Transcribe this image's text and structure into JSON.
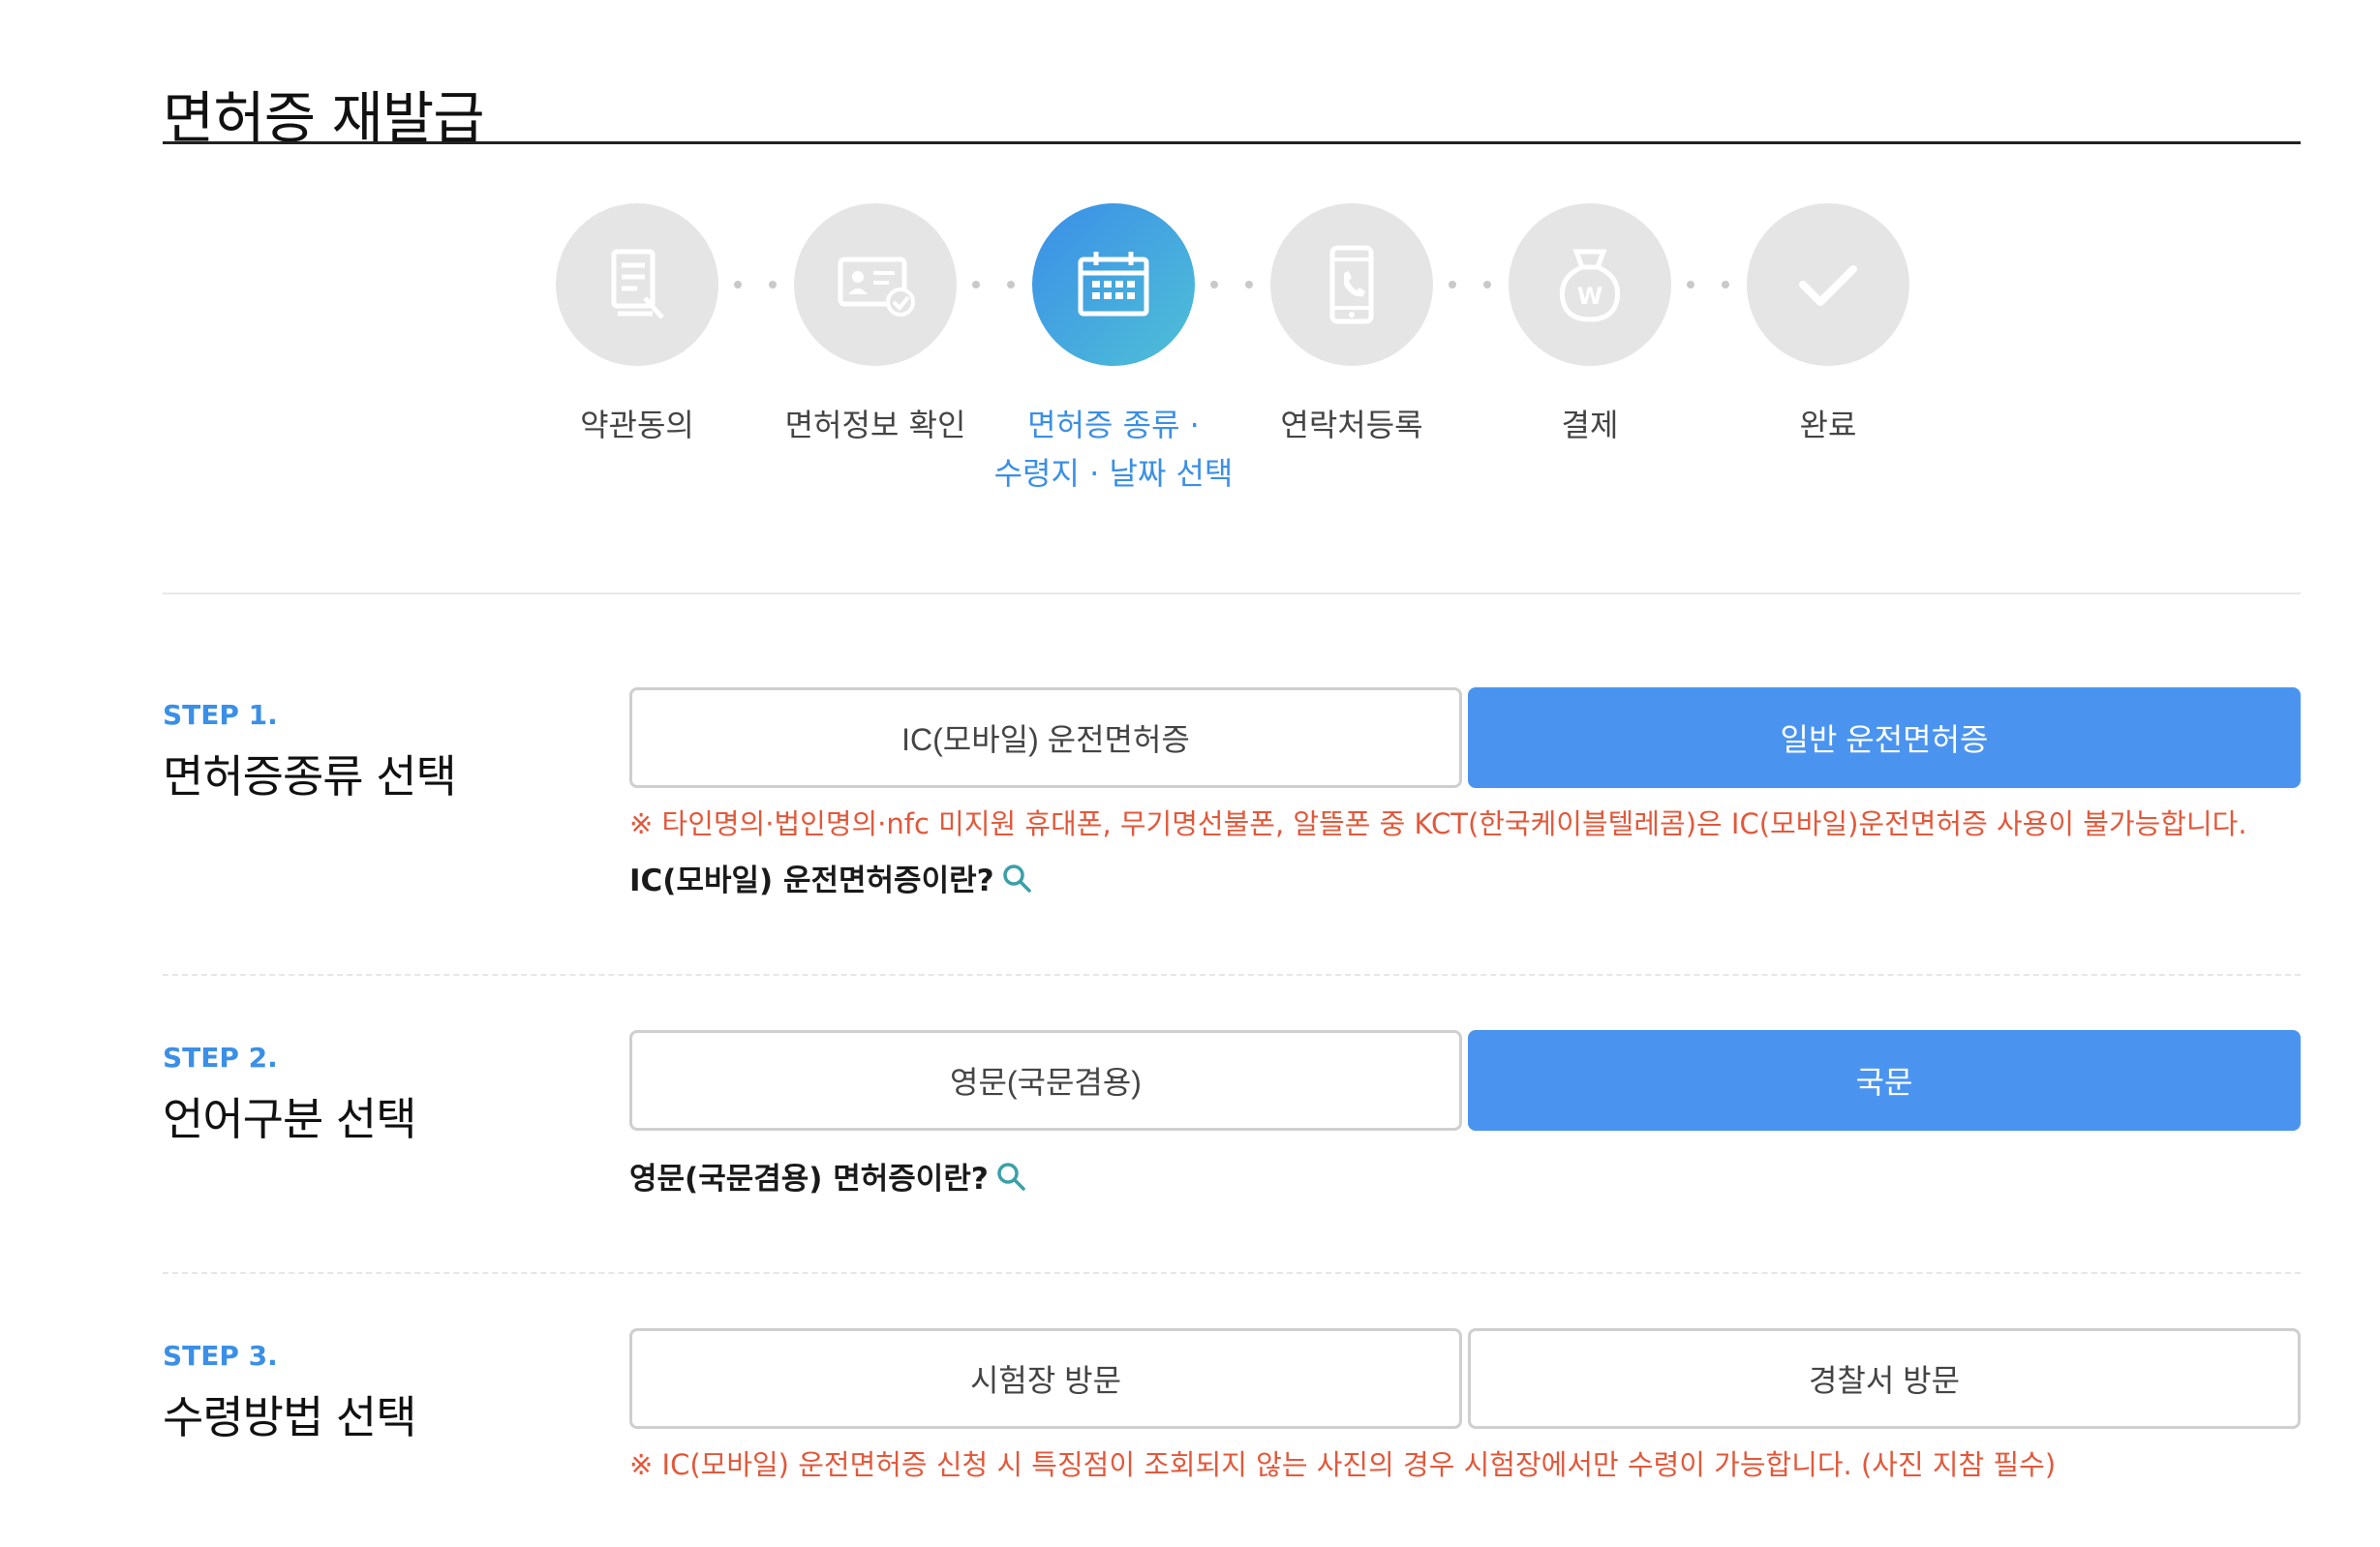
{
  "page": {
    "title": "면허증 재발급"
  },
  "stepper": {
    "steps": [
      {
        "icon": "document-pen-icon",
        "label_line1": "약관동의",
        "label_line2": ""
      },
      {
        "icon": "id-card-check-icon",
        "label_line1": "면허정보 확인",
        "label_line2": ""
      },
      {
        "icon": "calendar-icon",
        "label_line1": "면허증 종류 ·",
        "label_line2": "수령지 · 날짜 선택"
      },
      {
        "icon": "mobile-phone-icon",
        "label_line1": "연락처등록",
        "label_line2": ""
      },
      {
        "icon": "won-money-bag-icon",
        "label_line1": "결제",
        "label_line2": ""
      },
      {
        "icon": "checkmark-icon",
        "label_line1": "완료",
        "label_line2": ""
      }
    ],
    "active_index": 2
  },
  "sections": {
    "license_type": {
      "step_tag": "STEP 1.",
      "title": "면허증종류 선택",
      "options": [
        "IC(모바일) 운전면허증",
        "일반 운전면허증"
      ],
      "selected_index": 1,
      "note": "※ 타인명의·법인명의·nfc 미지원 휴대폰, 무기명선불폰, 알뜰폰 중 KCT(한국케이블텔레콤)은 IC(모바일)운전면허증 사용이 불가능합니다.",
      "help_link": "IC(모바일) 운전면허증이란?"
    },
    "language": {
      "step_tag": "STEP 2.",
      "title": "언어구분 선택",
      "options": [
        "영문(국문겸용)",
        "국문"
      ],
      "selected_index": 1,
      "help_link": "영문(국문겸용) 면허증이란?"
    },
    "receipt": {
      "step_tag": "STEP 3.",
      "title": "수령방법 선택",
      "options": [
        "시험장 방문",
        "경찰서 방문"
      ],
      "selected_index": -1,
      "note": "※ IC(모바일) 운전면허증 신청 시 특징점이 조회되지 않는 사진의 경우 시험장에서만 수령이 가능합니다. (사진 지참 필수)"
    }
  },
  "colors": {
    "accent_blue": "#4a94f0",
    "step_blue_text": "#3b8fe6",
    "note_red": "#e2583a",
    "inactive_circle": "#e5e5e5",
    "search_icon_teal": "#3aa0a8"
  }
}
